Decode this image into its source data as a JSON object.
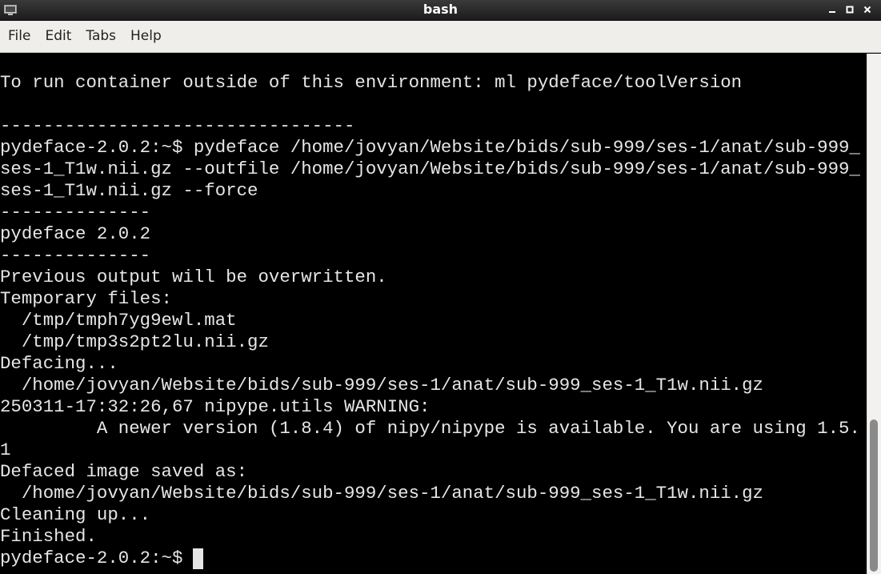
{
  "window": {
    "title": "bash",
    "icon": "terminal-icon",
    "controls": [
      "minimize-icon",
      "maximize-icon",
      "close-icon"
    ]
  },
  "menu": {
    "items": [
      {
        "label": "File"
      },
      {
        "label": "Edit"
      },
      {
        "label": "Tabs"
      },
      {
        "label": "Help"
      }
    ]
  },
  "terminal": {
    "lines": [
      "To run container outside of this environment: ml pydeface/toolVersion",
      "",
      "---------------------------------",
      "pydeface-2.0.2:~$ pydeface /home/jovyan/Website/bids/sub-999/ses-1/anat/sub-999_",
      "ses-1_T1w.nii.gz --outfile /home/jovyan/Website/bids/sub-999/ses-1/anat/sub-999_",
      "ses-1_T1w.nii.gz --force",
      "--------------",
      "pydeface 2.0.2",
      "--------------",
      "Previous output will be overwritten.",
      "Temporary files:",
      "  /tmp/tmph7yg9ewl.mat",
      "  /tmp/tmp3s2pt2lu.nii.gz",
      "Defacing...",
      "  /home/jovyan/Website/bids/sub-999/ses-1/anat/sub-999_ses-1_T1w.nii.gz",
      "250311-17:32:26,67 nipype.utils WARNING:",
      "         A newer version (1.8.4) of nipy/nipype is available. You are using 1.5.",
      "1",
      "Defaced image saved as:",
      "  /home/jovyan/Website/bids/sub-999/ses-1/anat/sub-999_ses-1_T1w.nii.gz",
      "Cleaning up...",
      "Finished."
    ],
    "prompt": "pydeface-2.0.2:~$"
  },
  "colors": {
    "terminal_bg": "#000000",
    "terminal_fg": "#e6e6e6",
    "titlebar_bg": "#2a2a2a",
    "menubar_bg": "#efeeeb"
  }
}
